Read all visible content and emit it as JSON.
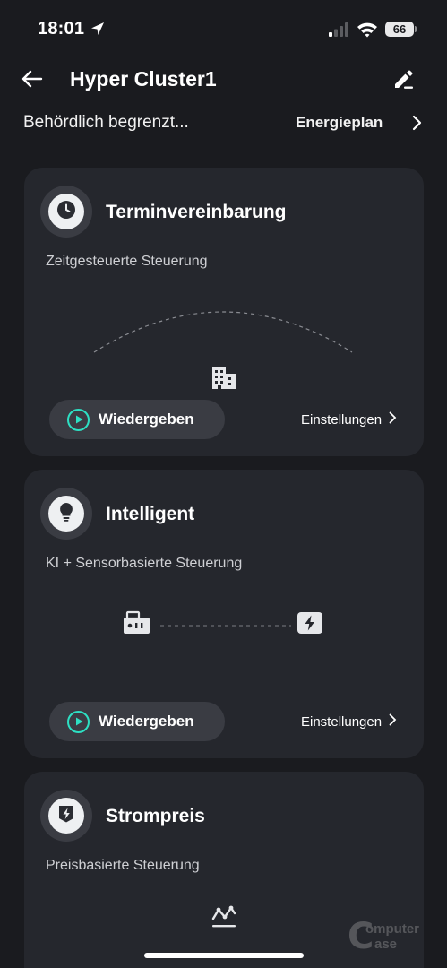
{
  "status_bar": {
    "time": "18:01",
    "battery": "66",
    "icons": [
      "location-arrow-icon",
      "cellular-signal-icon",
      "wifi-icon",
      "battery-icon"
    ]
  },
  "nav": {
    "title": "Hyper Cluster1",
    "back_icon": "back-arrow-icon",
    "edit_icon": "edit-pen-icon"
  },
  "subbar": {
    "status": "Behördlich begrenzt...",
    "plan_link": "Energieplan"
  },
  "cards": [
    {
      "title": "Terminvereinbarung",
      "subtitle": "Zeitgesteuerte Steuerung",
      "icon": "clock-icon",
      "illustration": "building-icon",
      "play_label": "Wiedergeben",
      "settings_label": "Einstellungen"
    },
    {
      "title": "Intelligent",
      "subtitle": "KI + Sensorbasierte Steuerung",
      "icon": "lightbulb-icon",
      "illustration": [
        "smart-meter-icon",
        "power-plug-icon"
      ],
      "play_label": "Wiedergeben",
      "settings_label": "Einstellungen"
    },
    {
      "title": "Strompreis",
      "subtitle": "Preisbasierte Steuerung",
      "icon": "price-bolt-icon",
      "illustration": "price-chart-icon"
    }
  ],
  "watermark": {
    "line1": "omputer",
    "line2": "ase"
  },
  "colors": {
    "background": "#1a1b1f",
    "card": "#25272d",
    "accent": "#2de0c3"
  }
}
